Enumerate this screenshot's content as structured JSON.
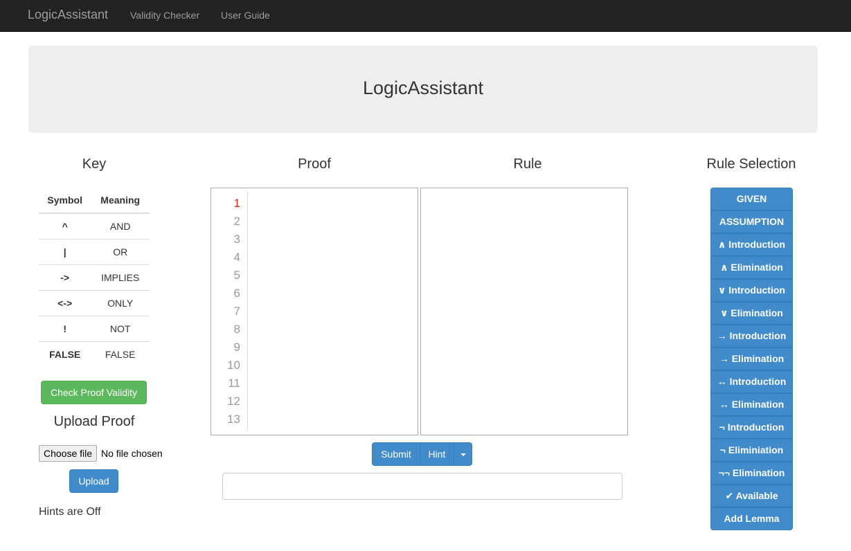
{
  "navbar": {
    "brand": "LogicAssistant",
    "links": [
      "Validity Checker",
      "User Guide"
    ]
  },
  "jumbotron": {
    "title": "LogicAssistant"
  },
  "key": {
    "title": "Key",
    "headers": [
      "Symbol",
      "Meaning"
    ],
    "rows": [
      [
        "^",
        "AND"
      ],
      [
        "|",
        "OR"
      ],
      [
        "->",
        "IMPLIES"
      ],
      [
        "<->",
        "ONLY"
      ],
      [
        "!",
        "NOT"
      ],
      [
        "FALSE",
        "FALSE"
      ]
    ],
    "check_button": "Check Proof Validity",
    "upload_title": "Upload Proof",
    "choose_file": "Choose file",
    "no_file": "No file chosen",
    "upload_button": "Upload",
    "hints_status": "Hints are Off"
  },
  "proof": {
    "title": "Proof",
    "line_numbers": [
      "1",
      "2",
      "3",
      "4",
      "5",
      "6",
      "7",
      "8",
      "9",
      "10",
      "11",
      "12",
      "13"
    ],
    "active_line": 1
  },
  "rule": {
    "title": "Rule"
  },
  "actions": {
    "submit": "Submit",
    "hint": "Hint"
  },
  "rule_selection": {
    "title": "Rule Selection",
    "buttons": [
      "GIVEN",
      "ASSUMPTION",
      "∧ Introduction",
      "∧ Elimination",
      "∨ Introduction",
      "∨ Elimination",
      "→ Introduction",
      "→ Elimination",
      "↔ Introduction",
      "↔ Elimination",
      "¬ Introduction",
      "¬ Eliminiation",
      "¬¬ Elimination",
      "✔ Available",
      "Add Lemma"
    ]
  },
  "colors": {
    "navbar": "#222222",
    "primary": "#428bca",
    "success": "#5cb85c",
    "active_line": "#dd2211"
  }
}
